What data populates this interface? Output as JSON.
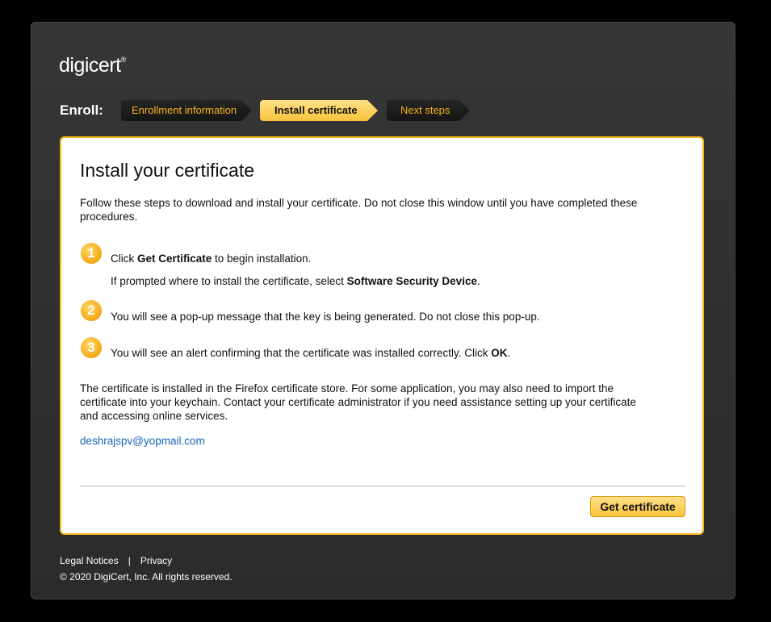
{
  "brand": {
    "name": "digicert",
    "mark": "®"
  },
  "enroll": {
    "label": "Enroll:",
    "steps": [
      {
        "label": "Enrollment information",
        "state": "done"
      },
      {
        "label": "Install certificate",
        "state": "active"
      },
      {
        "label": "Next steps",
        "state": "upcoming"
      }
    ]
  },
  "main": {
    "title": "Install your certificate",
    "intro": "Follow these steps to download and install your certificate. Do not close this window until you have completed these procedures.",
    "step1": {
      "number": "1",
      "pre": "Click ",
      "bold": "Get Certificate",
      "post": " to begin installation.",
      "sub_pre": "If prompted where to install the certificate, select ",
      "sub_bold": "Software Security Device",
      "sub_post": "."
    },
    "step2": {
      "number": "2",
      "text": "You will see a pop-up message that the key is being generated. Do not close this pop-up."
    },
    "step3": {
      "number": "3",
      "pre": "You will see an alert confirming that the certificate was installed correctly. Click ",
      "bold": "OK",
      "post": "."
    },
    "note": "The certificate is installed in the Firefox certificate store. For some application, you may also need to import the certificate into your keychain. Contact your certificate administrator if you need assistance setting up your certificate and accessing online services.",
    "email": "deshrajspv@yopmail.com",
    "button": "Get certificate"
  },
  "footer": {
    "legal": "Legal Notices",
    "separator": "|",
    "privacy": "Privacy",
    "copyright": "© 2020 DigiCert, Inc. All rights reserved."
  },
  "colors": {
    "accent": "#f7b719",
    "link": "#1566b8",
    "window_bg": "#313131"
  }
}
